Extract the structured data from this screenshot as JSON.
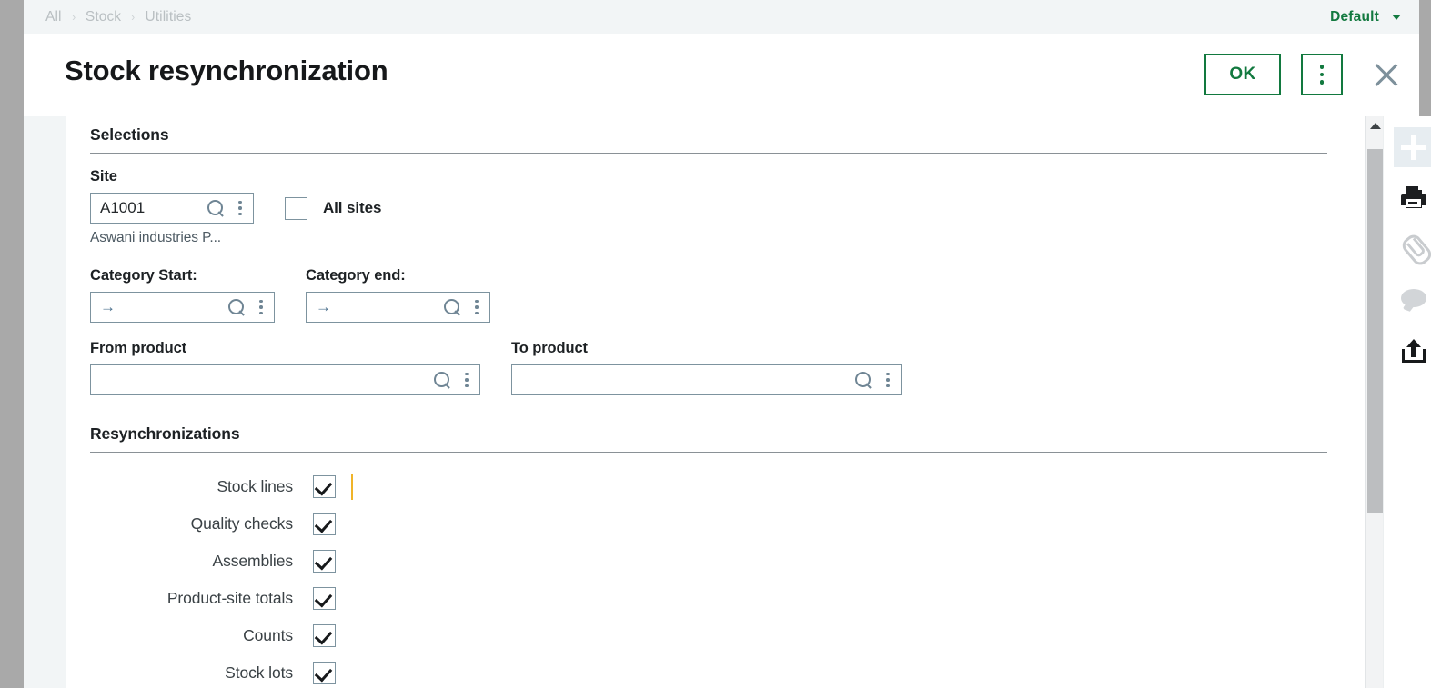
{
  "breadcrumb": {
    "items": [
      "All",
      "Stock",
      "Utilities"
    ],
    "separator": "›"
  },
  "header": {
    "default_label": "Default",
    "title": "Stock resynchronization",
    "ok_label": "OK"
  },
  "sections": {
    "selections": {
      "title": "Selections",
      "site": {
        "label": "Site",
        "value": "A1001",
        "helper": "Aswani industries P..."
      },
      "all_sites": {
        "label": "All sites",
        "checked": false
      },
      "category_start": {
        "label": "Category Start:",
        "value": "→"
      },
      "category_end": {
        "label": "Category end:",
        "value": "→"
      },
      "from_product": {
        "label": "From product",
        "value": ""
      },
      "to_product": {
        "label": "To product",
        "value": ""
      }
    },
    "resynchronizations": {
      "title": "Resynchronizations",
      "rows": [
        {
          "label": "Stock lines",
          "checked": true,
          "focused": true
        },
        {
          "label": "Quality checks",
          "checked": true,
          "focused": false
        },
        {
          "label": "Assemblies",
          "checked": true,
          "focused": false
        },
        {
          "label": "Product-site totals",
          "checked": true,
          "focused": false
        },
        {
          "label": "Counts",
          "checked": true,
          "focused": false
        },
        {
          "label": "Stock lots",
          "checked": true,
          "focused": false
        }
      ]
    }
  },
  "rail": {
    "items": [
      {
        "icon": "plus-icon",
        "state": "selected"
      },
      {
        "icon": "printer-icon",
        "state": "enabled"
      },
      {
        "icon": "paperclip-icon",
        "state": "disabled"
      },
      {
        "icon": "comment-icon",
        "state": "disabled"
      },
      {
        "icon": "upload-icon",
        "state": "enabled"
      }
    ]
  },
  "colors": {
    "accent_green": "#12793f",
    "field_border": "#7d939f",
    "focus_amber": "#f0b429",
    "icon_blue_grey": "#6f8594"
  }
}
